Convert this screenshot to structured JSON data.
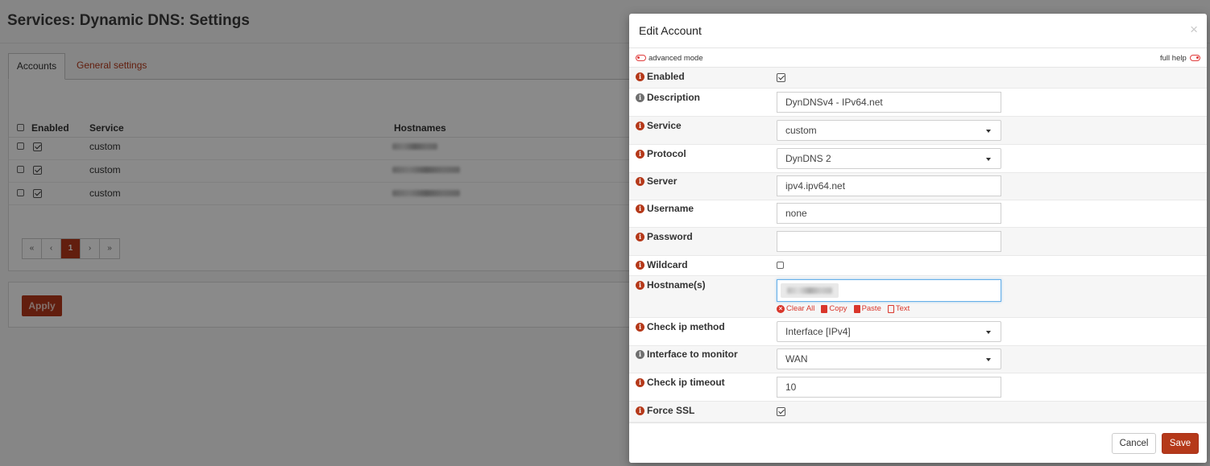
{
  "page": {
    "title": "Services: Dynamic DNS: Settings",
    "tabs": [
      {
        "label": "Accounts"
      },
      {
        "label": "General settings"
      }
    ],
    "grid": {
      "columns": [
        "Enabled",
        "Service",
        "Hostnames"
      ],
      "rows": [
        {
          "service": "custom",
          "enabled": true
        },
        {
          "service": "custom",
          "enabled": true
        },
        {
          "service": "custom",
          "enabled": true
        }
      ]
    },
    "pager": {
      "first": "«",
      "prev": "‹",
      "current": "1",
      "next": "›",
      "last": "»"
    },
    "apply_label": "Apply"
  },
  "modal": {
    "title": "Edit Account",
    "close": "×",
    "advanced_mode": "advanced mode",
    "full_help": "full help",
    "fields": {
      "enabled": {
        "label": "Enabled",
        "checked": true
      },
      "description": {
        "label": "Description",
        "value": "DynDNSv4 - IPv64.net"
      },
      "service": {
        "label": "Service",
        "value": "custom"
      },
      "protocol": {
        "label": "Protocol",
        "value": "DynDNS 2"
      },
      "server": {
        "label": "Server",
        "value": "ipv4.ipv64.net"
      },
      "username": {
        "label": "Username",
        "value": "none"
      },
      "password": {
        "label": "Password",
        "value": ""
      },
      "wildcard": {
        "label": "Wildcard",
        "checked": false
      },
      "hostnames": {
        "label": "Hostname(s)"
      },
      "check_ip_method": {
        "label": "Check ip method",
        "value": "Interface [IPv4]"
      },
      "interface": {
        "label": "Interface to monitor",
        "value": "WAN"
      },
      "timeout": {
        "label": "Check ip timeout",
        "value": "10"
      },
      "force_ssl": {
        "label": "Force SSL",
        "checked": true
      }
    },
    "token_actions": {
      "clear_all": "Clear All",
      "copy": "Copy",
      "paste": "Paste",
      "text": "Text"
    },
    "cancel_label": "Cancel",
    "save_label": "Save"
  },
  "colors": {
    "accent": "#b5391a",
    "danger": "#d9362b",
    "focus": "#66afe9"
  }
}
